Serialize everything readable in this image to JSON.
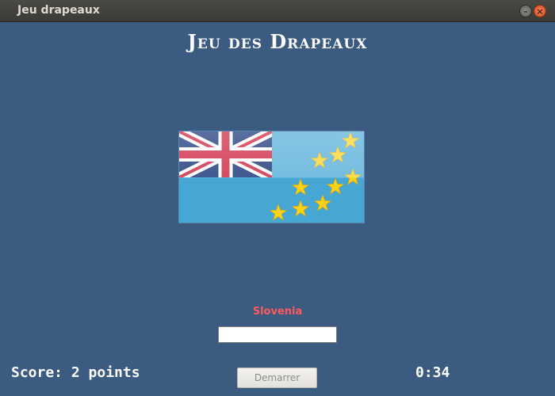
{
  "window": {
    "title": "Jeu drapeaux",
    "minimize_glyph": "–",
    "close_glyph": "×"
  },
  "game": {
    "title": "Jeu des Drapeaux",
    "flag_icon": "tuvalu-flag",
    "country_name": "Slovenia",
    "answer_value": "",
    "score_text": "Score: 2 points",
    "timer_text": "0:34",
    "start_label": "Demarrer"
  },
  "colors": {
    "background": "#3b5b80",
    "country_text": "#ff5a5a",
    "flag_sky": "#46a7d4",
    "flag_stars": "#fcd116"
  }
}
